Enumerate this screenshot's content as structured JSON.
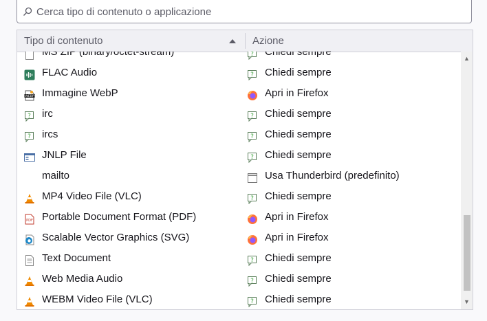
{
  "search": {
    "placeholder": "Cerca tipo di contenuto o applicazione"
  },
  "columns": {
    "type": "Tipo di contenuto",
    "action": "Azione"
  },
  "rows": [
    {
      "type_label": "MS ZIP (binary/octet-stream)",
      "type_icon": "generic-file-icon",
      "action_label": "Chiedi sempre",
      "action_icon": "ask-always-icon"
    },
    {
      "type_label": "FLAC Audio",
      "type_icon": "audio-wave-icon",
      "action_label": "Chiedi sempre",
      "action_icon": "ask-always-icon"
    },
    {
      "type_label": "Immagine WebP",
      "type_icon": "webp-file-icon",
      "action_label": "Apri in Firefox",
      "action_icon": "firefox-icon"
    },
    {
      "type_label": "irc",
      "type_icon": "ask-always-icon",
      "action_label": "Chiedi sempre",
      "action_icon": "ask-always-icon"
    },
    {
      "type_label": "ircs",
      "type_icon": "ask-always-icon",
      "action_label": "Chiedi sempre",
      "action_icon": "ask-always-icon"
    },
    {
      "type_label": "JNLP File",
      "type_icon": "window-file-icon",
      "action_label": "Chiedi sempre",
      "action_icon": "ask-always-icon"
    },
    {
      "type_label": "mailto",
      "type_icon": "",
      "action_label": "Usa Thunderbird (predefinito)",
      "action_icon": "application-icon"
    },
    {
      "type_label": "MP4 Video File (VLC)",
      "type_icon": "vlc-cone-icon",
      "action_label": "Chiedi sempre",
      "action_icon": "ask-always-icon"
    },
    {
      "type_label": "Portable Document Format (PDF)",
      "type_icon": "pdf-file-icon",
      "action_label": "Apri in Firefox",
      "action_icon": "firefox-icon"
    },
    {
      "type_label": "Scalable Vector Graphics (SVG)",
      "type_icon": "edge-file-icon",
      "action_label": "Apri in Firefox",
      "action_icon": "firefox-icon"
    },
    {
      "type_label": "Text Document",
      "type_icon": "text-document-icon",
      "action_label": "Chiedi sempre",
      "action_icon": "ask-always-icon"
    },
    {
      "type_label": "Web Media Audio",
      "type_icon": "vlc-cone-icon",
      "action_label": "Chiedi sempre",
      "action_icon": "ask-always-icon"
    },
    {
      "type_label": "WEBM Video File (VLC)",
      "type_icon": "vlc-cone-icon",
      "action_label": "Chiedi sempre",
      "action_icon": "ask-always-icon"
    }
  ],
  "colors": {
    "accent_green": "#3fa63f",
    "firefox_orange": "#ff7139",
    "vlc_orange": "#f08a00"
  }
}
